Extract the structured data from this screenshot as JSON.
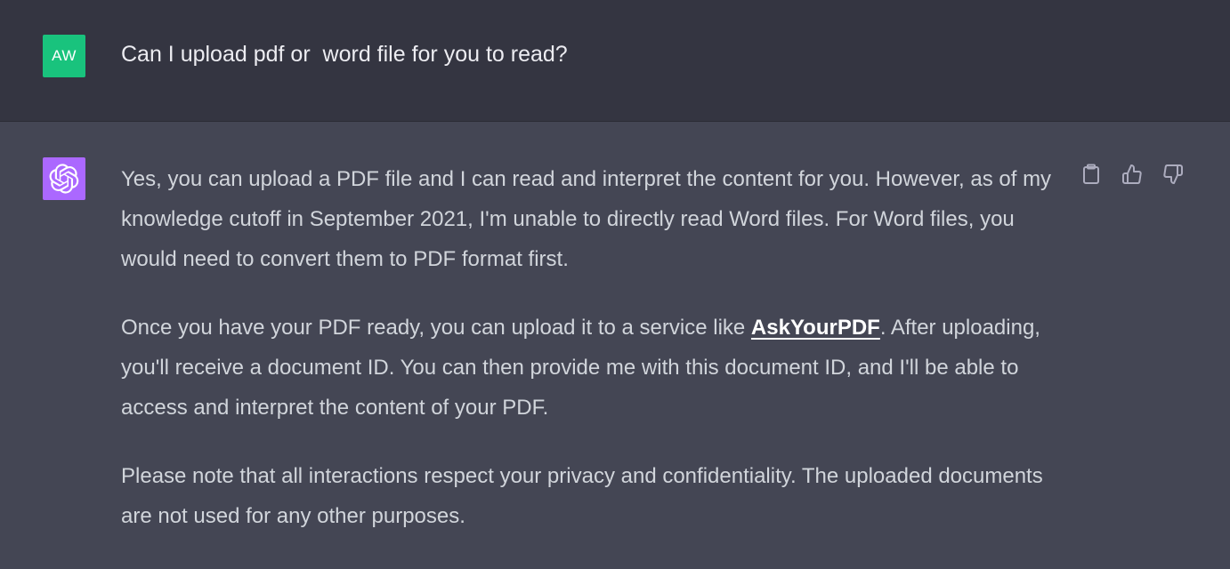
{
  "colors": {
    "user_avatar_bg": "#19c37d",
    "bot_avatar_bg": "#ab68ff"
  },
  "user": {
    "avatar_initials": "AW",
    "message": "Can I upload pdf or  word file for you to read?"
  },
  "assistant": {
    "avatar_icon": "openai-logo-icon",
    "paragraphs": [
      {
        "text": "Yes, you can upload a PDF file and I can read and interpret the content for you. However, as of my knowledge cutoff in September 2021, I'm unable to directly read Word files. For Word files, you would need to convert them to PDF format first."
      },
      {
        "before_link": "Once you have your PDF ready, you can upload it to a service like ",
        "link_text": "AskYourPDF",
        "after_link": ". After uploading, you'll receive a document ID. You can then provide me with this document ID, and I'll be able to access and interpret the content of your PDF."
      },
      {
        "text": "Please note that all interactions respect your privacy and confidentiality. The uploaded documents are not used for any other purposes."
      }
    ],
    "actions": [
      {
        "icon": "clipboard-icon"
      },
      {
        "icon": "thumbs-up-icon"
      },
      {
        "icon": "thumbs-down-icon"
      }
    ]
  }
}
